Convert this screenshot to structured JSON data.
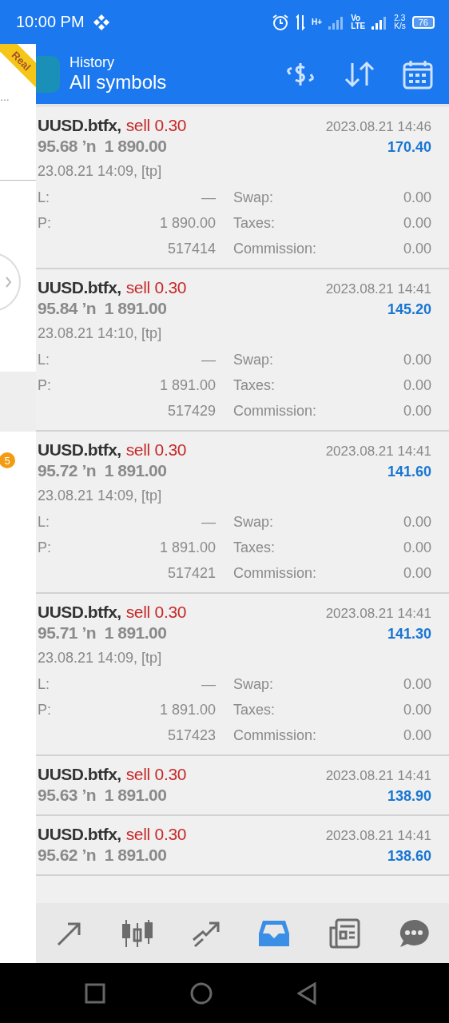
{
  "status_bar": {
    "time": "10:00 PM",
    "network": "H+",
    "volte": [
      "Vo",
      "LTE"
    ],
    "speed": [
      "2.3",
      "K/s"
    ],
    "battery": "76"
  },
  "sidebar": {
    "snippet": "…",
    "badge": "5",
    "ribbon": "Real"
  },
  "header": {
    "title": "History",
    "subtitle": "All symbols"
  },
  "deals": [
    {
      "kind": "expanded",
      "symbol": "UUSD.btfx,",
      "side": "sell 0.30",
      "prices": "95.68 ’n  1 890.00",
      "time": "2023.08.21 14:46",
      "profit": "170.40",
      "open_time": "23.08.21 14:09, [tp]",
      "details": [
        {
          "label": "L:",
          "value": "—",
          "label_2": "Swap:",
          "value_2": "0.00"
        },
        {
          "label": "P:",
          "value": "1 890.00",
          "label_2": "Taxes:",
          "value_2": "0.00"
        },
        {
          "value": "517414",
          "label_2": "Commission:",
          "value_2": "0.00"
        }
      ]
    },
    {
      "kind": "expanded",
      "symbol": "UUSD.btfx,",
      "side": "sell 0.30",
      "prices": "95.84 ’n  1 891.00",
      "time": "2023.08.21 14:41",
      "profit": "145.20",
      "open_time": "23.08.21 14:10, [tp]",
      "details": [
        {
          "label": "L:",
          "value": "—",
          "label_2": "Swap:",
          "value_2": "0.00"
        },
        {
          "label": "P:",
          "value": "1 891.00",
          "label_2": "Taxes:",
          "value_2": "0.00"
        },
        {
          "value": "517429",
          "label_2": "Commission:",
          "value_2": "0.00"
        }
      ]
    },
    {
      "kind": "expanded",
      "symbol": "UUSD.btfx,",
      "side": "sell 0.30",
      "prices": "95.72 ’n  1 891.00",
      "time": "2023.08.21 14:41",
      "profit": "141.60",
      "open_time": "23.08.21 14:09, [tp]",
      "details": [
        {
          "label": "L:",
          "value": "—",
          "label_2": "Swap:",
          "value_2": "0.00"
        },
        {
          "label": "P:",
          "value": "1 891.00",
          "label_2": "Taxes:",
          "value_2": "0.00"
        },
        {
          "value": "517421",
          "label_2": "Commission:",
          "value_2": "0.00"
        }
      ]
    },
    {
      "kind": "expanded",
      "symbol": "UUSD.btfx,",
      "side": "sell 0.30",
      "prices": "95.71 ’n  1 891.00",
      "time": "2023.08.21 14:41",
      "profit": "141.30",
      "open_time": "23.08.21 14:09, [tp]",
      "details": [
        {
          "label": "L:",
          "value": "—",
          "label_2": "Swap:",
          "value_2": "0.00"
        },
        {
          "label": "P:",
          "value": "1 891.00",
          "label_2": "Taxes:",
          "value_2": "0.00"
        },
        {
          "value": "517423",
          "label_2": "Commission:",
          "value_2": "0.00"
        }
      ]
    },
    {
      "kind": "collapsed",
      "symbol": "UUSD.btfx,",
      "side": "sell 0.30",
      "prices": "95.63 ’n  1 891.00",
      "time": "2023.08.21 14:41",
      "profit": "138.90"
    },
    {
      "kind": "collapsed",
      "symbol": "UUSD.btfx,",
      "side": "sell 0.30",
      "prices": "95.62 ’n  1 891.00",
      "time": "2023.08.21 14:41",
      "profit": "138.60"
    }
  ],
  "bottom_nav": [
    {
      "kind": "quotes",
      "selected": false
    },
    {
      "kind": "chart",
      "selected": false
    },
    {
      "kind": "trade",
      "selected": false
    },
    {
      "kind": "history",
      "selected": true
    },
    {
      "kind": "news",
      "selected": false
    },
    {
      "kind": "chat",
      "selected": false
    }
  ]
}
